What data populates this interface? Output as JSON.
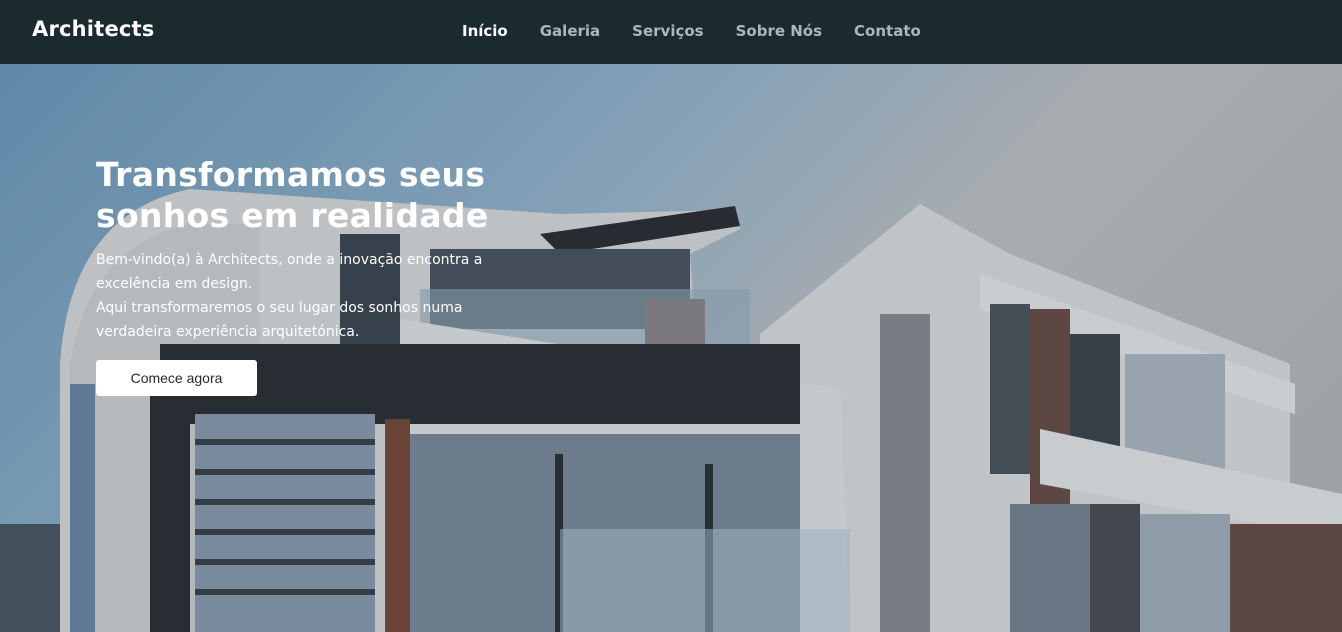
{
  "brand": "Architects",
  "nav": {
    "items": [
      "Início",
      "Galeria",
      "Serviços",
      "Sobre Nós",
      "Contato"
    ],
    "active": "Início"
  },
  "hero": {
    "title_line1": "Transformamos seus",
    "title_line2": "sonhos em realidade",
    "text_lines": [
      "Bem-vindo(a) à Architects, onde a inovação encontra a",
      "excelência em design.",
      "Aqui transformaremos o seu lugar dos sonhos numa",
      "verdadeira experiência arquitetónica."
    ],
    "cta_label": "Comece agora"
  },
  "colors": {
    "navbar_bg": "#1b2a2f",
    "nav_active": "#ffffff",
    "nav_inactive": "#aeb6b9",
    "button_bg": "#ffffff"
  }
}
